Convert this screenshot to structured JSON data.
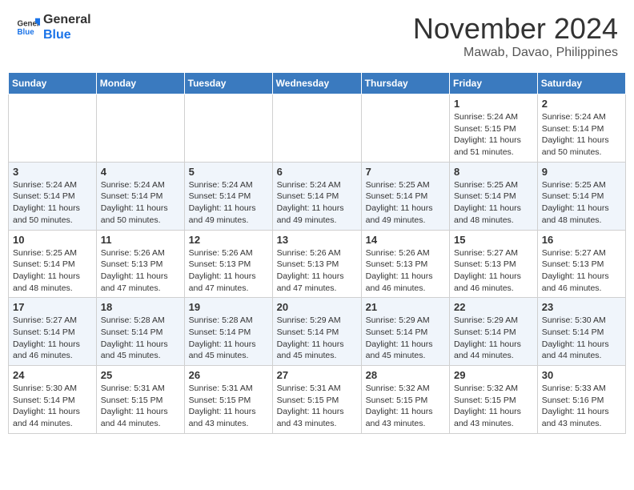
{
  "header": {
    "logo_line1": "General",
    "logo_line2": "Blue",
    "month_title": "November 2024",
    "location": "Mawab, Davao, Philippines"
  },
  "days_of_week": [
    "Sunday",
    "Monday",
    "Tuesday",
    "Wednesday",
    "Thursday",
    "Friday",
    "Saturday"
  ],
  "weeks": [
    [
      {
        "day": "",
        "info": ""
      },
      {
        "day": "",
        "info": ""
      },
      {
        "day": "",
        "info": ""
      },
      {
        "day": "",
        "info": ""
      },
      {
        "day": "",
        "info": ""
      },
      {
        "day": "1",
        "info": "Sunrise: 5:24 AM\nSunset: 5:15 PM\nDaylight: 11 hours\nand 51 minutes."
      },
      {
        "day": "2",
        "info": "Sunrise: 5:24 AM\nSunset: 5:14 PM\nDaylight: 11 hours\nand 50 minutes."
      }
    ],
    [
      {
        "day": "3",
        "info": "Sunrise: 5:24 AM\nSunset: 5:14 PM\nDaylight: 11 hours\nand 50 minutes."
      },
      {
        "day": "4",
        "info": "Sunrise: 5:24 AM\nSunset: 5:14 PM\nDaylight: 11 hours\nand 50 minutes."
      },
      {
        "day": "5",
        "info": "Sunrise: 5:24 AM\nSunset: 5:14 PM\nDaylight: 11 hours\nand 49 minutes."
      },
      {
        "day": "6",
        "info": "Sunrise: 5:24 AM\nSunset: 5:14 PM\nDaylight: 11 hours\nand 49 minutes."
      },
      {
        "day": "7",
        "info": "Sunrise: 5:25 AM\nSunset: 5:14 PM\nDaylight: 11 hours\nand 49 minutes."
      },
      {
        "day": "8",
        "info": "Sunrise: 5:25 AM\nSunset: 5:14 PM\nDaylight: 11 hours\nand 48 minutes."
      },
      {
        "day": "9",
        "info": "Sunrise: 5:25 AM\nSunset: 5:14 PM\nDaylight: 11 hours\nand 48 minutes."
      }
    ],
    [
      {
        "day": "10",
        "info": "Sunrise: 5:25 AM\nSunset: 5:14 PM\nDaylight: 11 hours\nand 48 minutes."
      },
      {
        "day": "11",
        "info": "Sunrise: 5:26 AM\nSunset: 5:13 PM\nDaylight: 11 hours\nand 47 minutes."
      },
      {
        "day": "12",
        "info": "Sunrise: 5:26 AM\nSunset: 5:13 PM\nDaylight: 11 hours\nand 47 minutes."
      },
      {
        "day": "13",
        "info": "Sunrise: 5:26 AM\nSunset: 5:13 PM\nDaylight: 11 hours\nand 47 minutes."
      },
      {
        "day": "14",
        "info": "Sunrise: 5:26 AM\nSunset: 5:13 PM\nDaylight: 11 hours\nand 46 minutes."
      },
      {
        "day": "15",
        "info": "Sunrise: 5:27 AM\nSunset: 5:13 PM\nDaylight: 11 hours\nand 46 minutes."
      },
      {
        "day": "16",
        "info": "Sunrise: 5:27 AM\nSunset: 5:13 PM\nDaylight: 11 hours\nand 46 minutes."
      }
    ],
    [
      {
        "day": "17",
        "info": "Sunrise: 5:27 AM\nSunset: 5:14 PM\nDaylight: 11 hours\nand 46 minutes."
      },
      {
        "day": "18",
        "info": "Sunrise: 5:28 AM\nSunset: 5:14 PM\nDaylight: 11 hours\nand 45 minutes."
      },
      {
        "day": "19",
        "info": "Sunrise: 5:28 AM\nSunset: 5:14 PM\nDaylight: 11 hours\nand 45 minutes."
      },
      {
        "day": "20",
        "info": "Sunrise: 5:29 AM\nSunset: 5:14 PM\nDaylight: 11 hours\nand 45 minutes."
      },
      {
        "day": "21",
        "info": "Sunrise: 5:29 AM\nSunset: 5:14 PM\nDaylight: 11 hours\nand 45 minutes."
      },
      {
        "day": "22",
        "info": "Sunrise: 5:29 AM\nSunset: 5:14 PM\nDaylight: 11 hours\nand 44 minutes."
      },
      {
        "day": "23",
        "info": "Sunrise: 5:30 AM\nSunset: 5:14 PM\nDaylight: 11 hours\nand 44 minutes."
      }
    ],
    [
      {
        "day": "24",
        "info": "Sunrise: 5:30 AM\nSunset: 5:14 PM\nDaylight: 11 hours\nand 44 minutes."
      },
      {
        "day": "25",
        "info": "Sunrise: 5:31 AM\nSunset: 5:15 PM\nDaylight: 11 hours\nand 44 minutes."
      },
      {
        "day": "26",
        "info": "Sunrise: 5:31 AM\nSunset: 5:15 PM\nDaylight: 11 hours\nand 43 minutes."
      },
      {
        "day": "27",
        "info": "Sunrise: 5:31 AM\nSunset: 5:15 PM\nDaylight: 11 hours\nand 43 minutes."
      },
      {
        "day": "28",
        "info": "Sunrise: 5:32 AM\nSunset: 5:15 PM\nDaylight: 11 hours\nand 43 minutes."
      },
      {
        "day": "29",
        "info": "Sunrise: 5:32 AM\nSunset: 5:15 PM\nDaylight: 11 hours\nand 43 minutes."
      },
      {
        "day": "30",
        "info": "Sunrise: 5:33 AM\nSunset: 5:16 PM\nDaylight: 11 hours\nand 43 minutes."
      }
    ]
  ]
}
